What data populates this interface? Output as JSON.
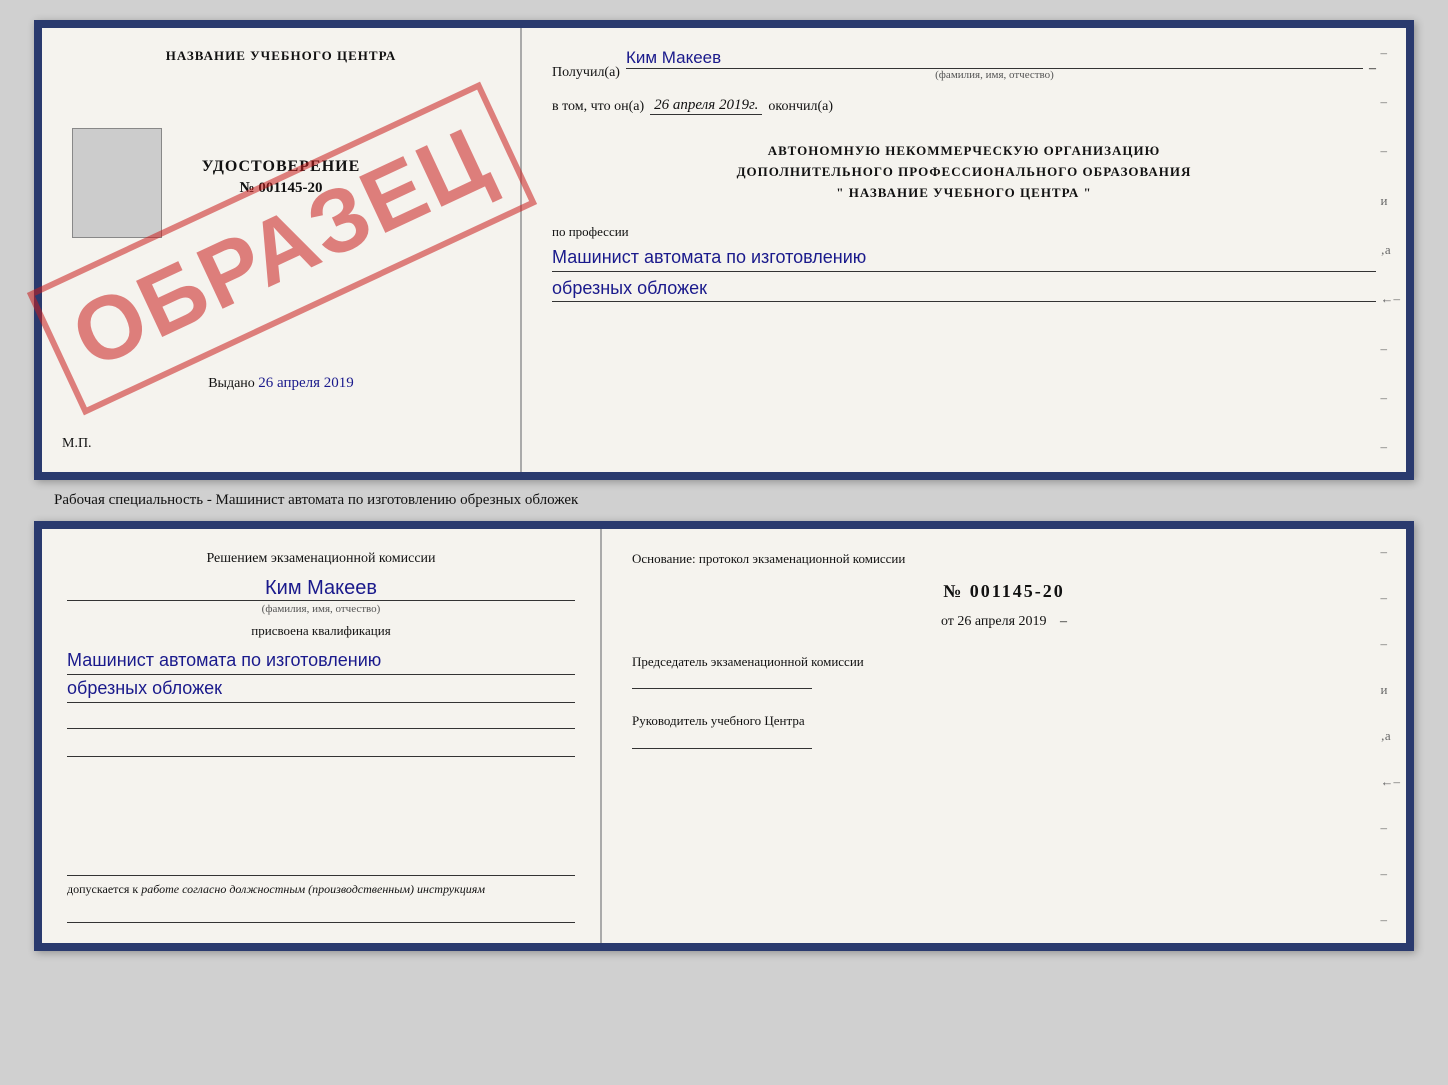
{
  "top_document": {
    "left": {
      "training_center": "НАЗВАНИЕ УЧЕБНОГО ЦЕНТРА",
      "obrazec": "ОБРАЗЕЦ",
      "udostoverenie": "УДОСТОВЕРЕНИЕ",
      "number": "№ 001145-20",
      "vydano": "Выдано",
      "vydano_date": "26 апреля 2019",
      "mp": "М.П."
    },
    "right": {
      "poluchil_label": "Получил(а)",
      "poluchil_value": "Ким Макеев",
      "fio_sub": "(фамилия, имя, отчество)",
      "vtom_label": "в том, что он(а)",
      "vtom_date": "26 апреля 2019г.",
      "okonchil": "окончил(а)",
      "org_line1": "АВТОНОМНУЮ НЕКОММЕРЧЕСКУЮ ОРГАНИЗАЦИЮ",
      "org_line2": "ДОПОЛНИТЕЛЬНОГО ПРОФЕССИОНАЛЬНОГО ОБРАЗОВАНИЯ",
      "org_line3": "\"   НАЗВАНИЕ УЧЕБНОГО ЦЕНТРА   \"",
      "professia_label": "по профессии",
      "professia_value1": "Машинист автомата по изготовлению",
      "professia_value2": "обрезных обложек"
    }
  },
  "caption": "Рабочая специальность - Машинист автомата по изготовлению обрезных обложек",
  "bottom_document": {
    "left": {
      "reshenie_title": "Решением экзаменационной комиссии",
      "name": "Ким Макеев",
      "fio_sub": "(фамилия, имя, отчество)",
      "prisvoena_label": "присвоена квалификация",
      "kvalif_line1": "Машинист автомата по изготовлению",
      "kvalif_line2": "обрезных обложек",
      "dopusk_label": "допускается к",
      "dopusk_value": "работе согласно должностным (производственным) инструкциям"
    },
    "right": {
      "osnovanie_label": "Основание: протокол экзаменационной комиссии",
      "protocol_number": "№  001145-20",
      "ot_label": "от",
      "ot_date": "26 апреля 2019",
      "predsedatel_label": "Председатель экзаменационной комиссии",
      "rukovoditel_label": "Руководитель учебного Центра"
    }
  }
}
